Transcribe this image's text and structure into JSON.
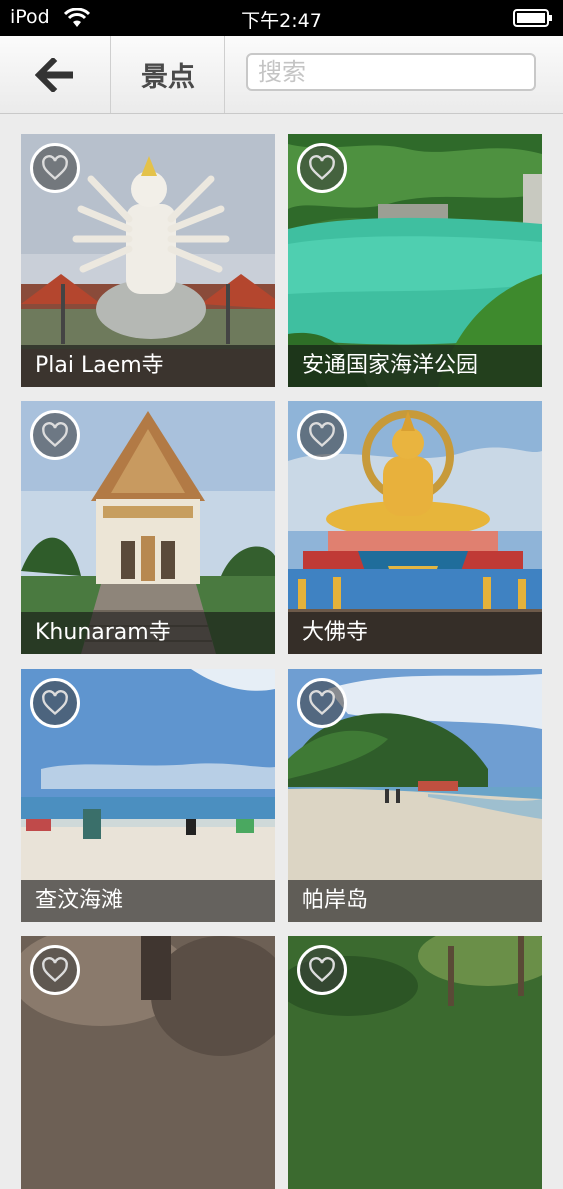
{
  "status_bar": {
    "carrier": "iPod",
    "time": "下午2:47"
  },
  "nav": {
    "title": "景点",
    "search_placeholder": "搜索"
  },
  "attractions": [
    {
      "name": "Plai Laem寺"
    },
    {
      "name": "安通国家海洋公园"
    },
    {
      "name": "Khunaram寺"
    },
    {
      "name": "大佛寺"
    },
    {
      "name": "查汶海滩"
    },
    {
      "name": "帕岸岛"
    },
    {
      "name": ""
    },
    {
      "name": ""
    }
  ],
  "icons": {
    "back": "back-arrow-icon",
    "favorite": "heart-icon",
    "wifi": "wifi-icon",
    "battery": "battery-icon"
  }
}
